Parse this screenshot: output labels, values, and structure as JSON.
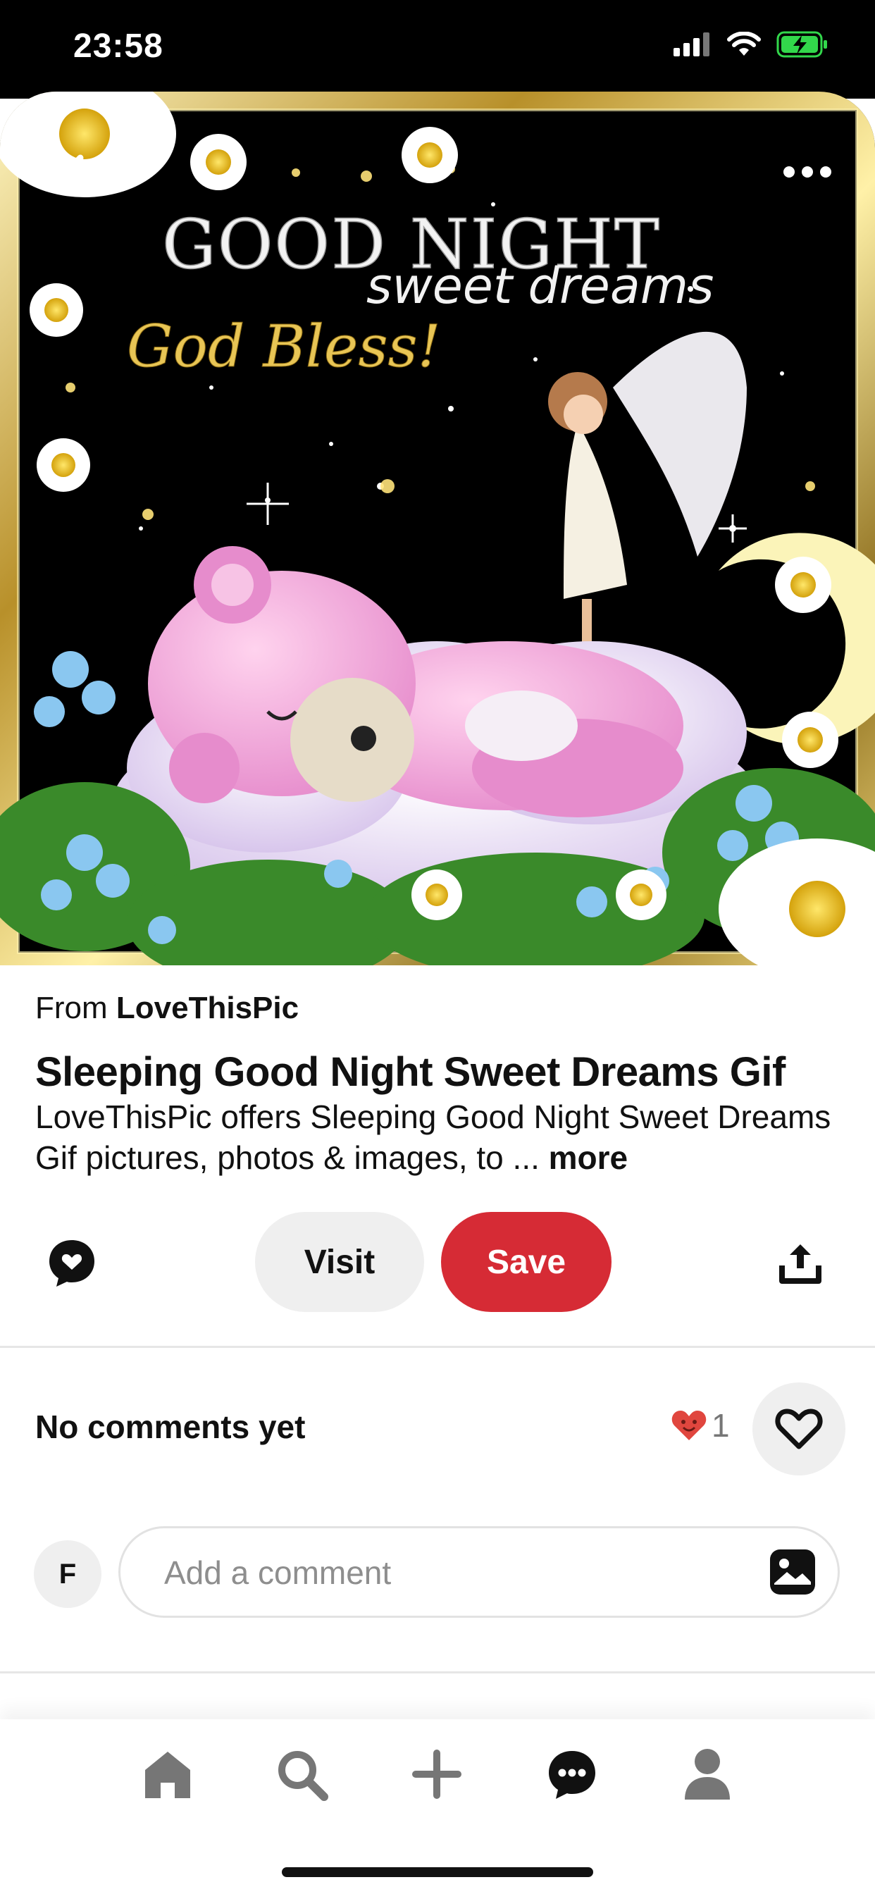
{
  "status_bar": {
    "time": "23:58"
  },
  "pin": {
    "image_text": {
      "line1": "GOOD NIGHT",
      "line2": "sweet dreams",
      "line3": "God Bless!"
    },
    "source_prefix": "From",
    "source_name": "LoveThisPic",
    "title": "Sleeping Good Night Sweet Dreams Gif",
    "description": "LoveThisPic offers Sleeping Good Night Sweet Dreams Gif pictures, photos & images, to ...",
    "more_label": "more"
  },
  "actions": {
    "visit_label": "Visit",
    "save_label": "Save"
  },
  "comments": {
    "empty_label": "No comments yet",
    "reaction_count": "1",
    "avatar_initial": "F",
    "input_placeholder": "Add a comment"
  },
  "colors": {
    "save": "#d62b35",
    "reaction_heart": "#e0463e",
    "icon": "#767676"
  },
  "icons": {
    "status": [
      "signal-icon",
      "wifi-icon",
      "battery-charging-icon"
    ],
    "hero": [
      "back-chevron-icon",
      "more-options-icon"
    ],
    "actions": [
      "comment-bubble-icon",
      "share-icon"
    ],
    "nav": [
      "home-icon",
      "search-icon",
      "create-plus-icon",
      "messages-icon",
      "profile-icon"
    ]
  }
}
